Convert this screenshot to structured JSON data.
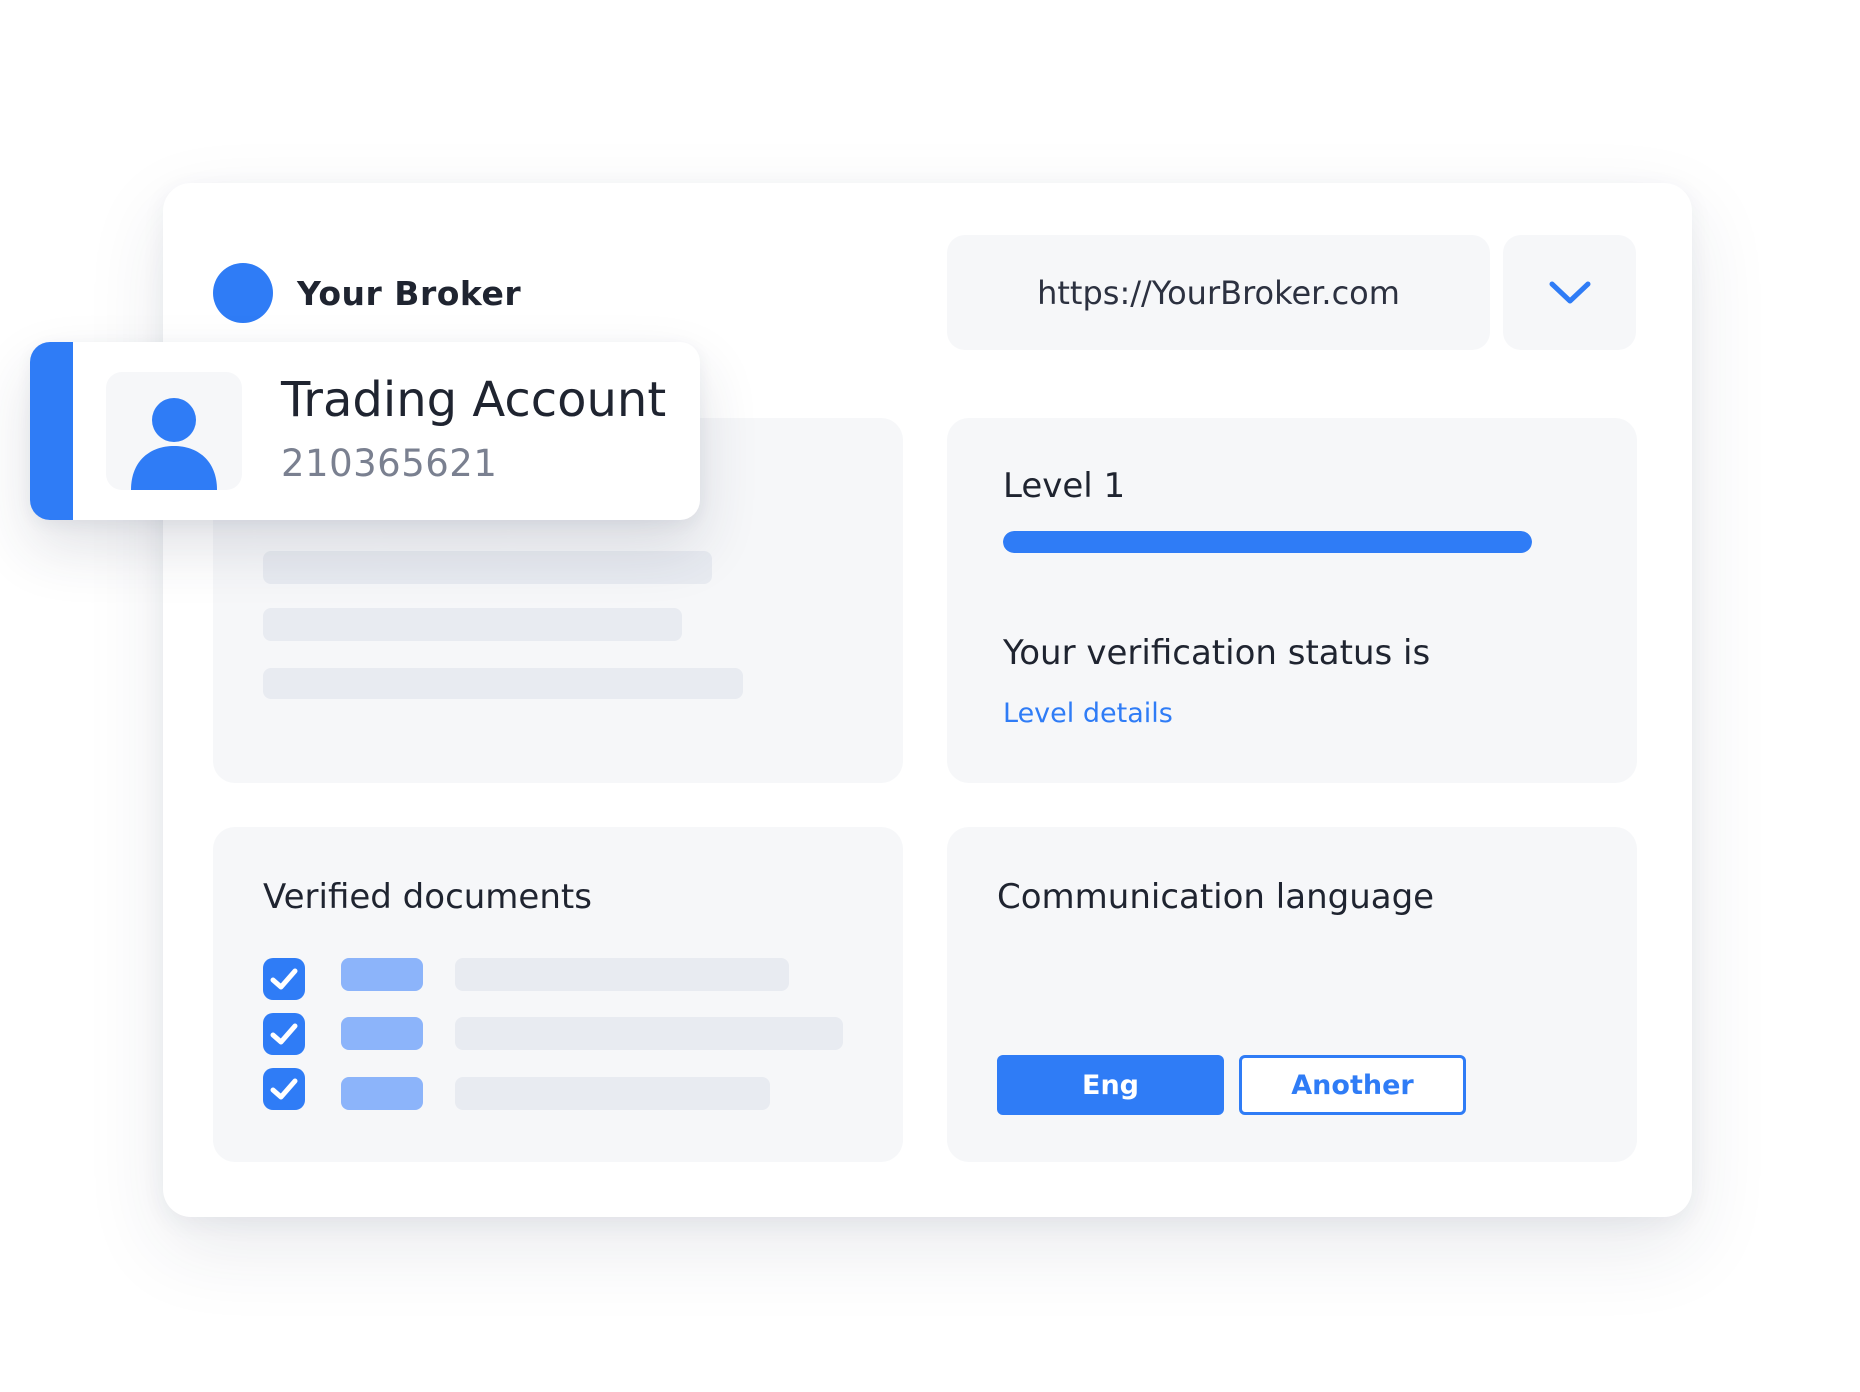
{
  "colors": {
    "accent": "#2f7cf6",
    "panel_background": "#f6f7f9",
    "skeleton": "#e8ebf1",
    "doc_chip": "#8cb4fa",
    "text_primary": "#1f2430",
    "text_secondary": "#7a8090"
  },
  "brand": {
    "name": "Your Broker",
    "logo_icon": "circle-logo"
  },
  "address_bar": {
    "url": "https://YourBroker.com",
    "dropdown_icon": "chevron-down-icon"
  },
  "account_card": {
    "title": "Trading Account",
    "number": "210365621",
    "avatar_icon": "user-icon"
  },
  "verification": {
    "level_label": "Level 1",
    "progress": 1.0,
    "status_text": "Your verification status is",
    "details_link": "Level details"
  },
  "documents": {
    "title": "Verified documents",
    "items": [
      {
        "checked": true,
        "icon": "checkbox-checked-icon"
      },
      {
        "checked": true,
        "icon": "checkbox-checked-icon"
      },
      {
        "checked": true,
        "icon": "checkbox-checked-icon"
      }
    ]
  },
  "language": {
    "title": "Communication language",
    "options": [
      {
        "label": "Eng",
        "selected": true
      },
      {
        "label": "Another",
        "selected": false
      }
    ]
  }
}
